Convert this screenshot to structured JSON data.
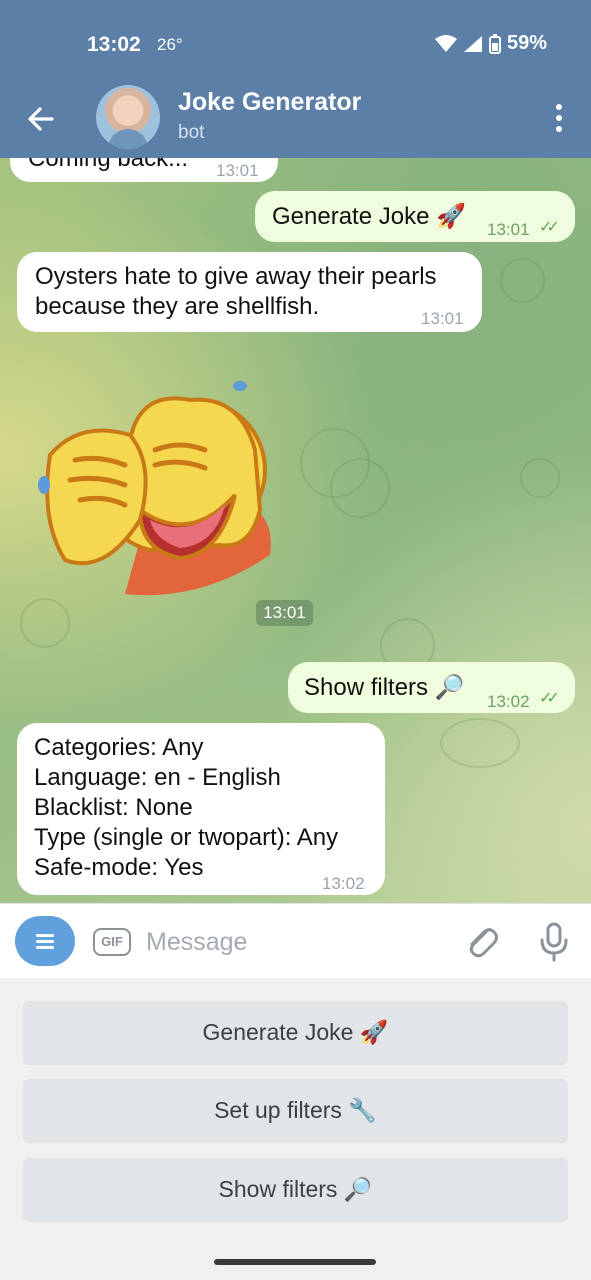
{
  "status_bar": {
    "time": "13:02",
    "temperature": "26°",
    "battery": "59%"
  },
  "header": {
    "title": "Joke Generator",
    "subtitle": "bot"
  },
  "messages": {
    "m0": {
      "text": "Coming back...",
      "time": "13:01"
    },
    "m1": {
      "text": "Generate Joke 🚀",
      "time": "13:01"
    },
    "m2": {
      "line1": "Oysters hate to give away their pearls",
      "line2": "because they are shellfish.",
      "time": "13:01"
    },
    "sticker": {
      "time": "13:01"
    },
    "m3": {
      "text": "Show filters 🔎",
      "time": "13:02"
    },
    "m4": {
      "lines": [
        "Categories: Any",
        "Language: en - English",
        "Blacklist: None",
        "Type (single or twopart): Any",
        "Safe-mode: Yes"
      ],
      "time": "13:02"
    }
  },
  "composer": {
    "gif_label": "GIF",
    "placeholder": "Message"
  },
  "keyboard": {
    "buttons": [
      "Generate Joke 🚀",
      "Set up filters 🔧",
      "Show filters 🔎"
    ]
  },
  "colors": {
    "header": "#5b7fa6",
    "outgoing_bubble": "#effdde",
    "incoming_bubble": "#ffffff",
    "accent": "#5fa0dd"
  },
  "icons": [
    "back-arrow-icon",
    "more-vert-icon",
    "menu-icon",
    "gif-icon",
    "attach-icon",
    "mic-icon",
    "wifi-icon",
    "signal-icon",
    "battery-icon",
    "double-check-icon"
  ]
}
